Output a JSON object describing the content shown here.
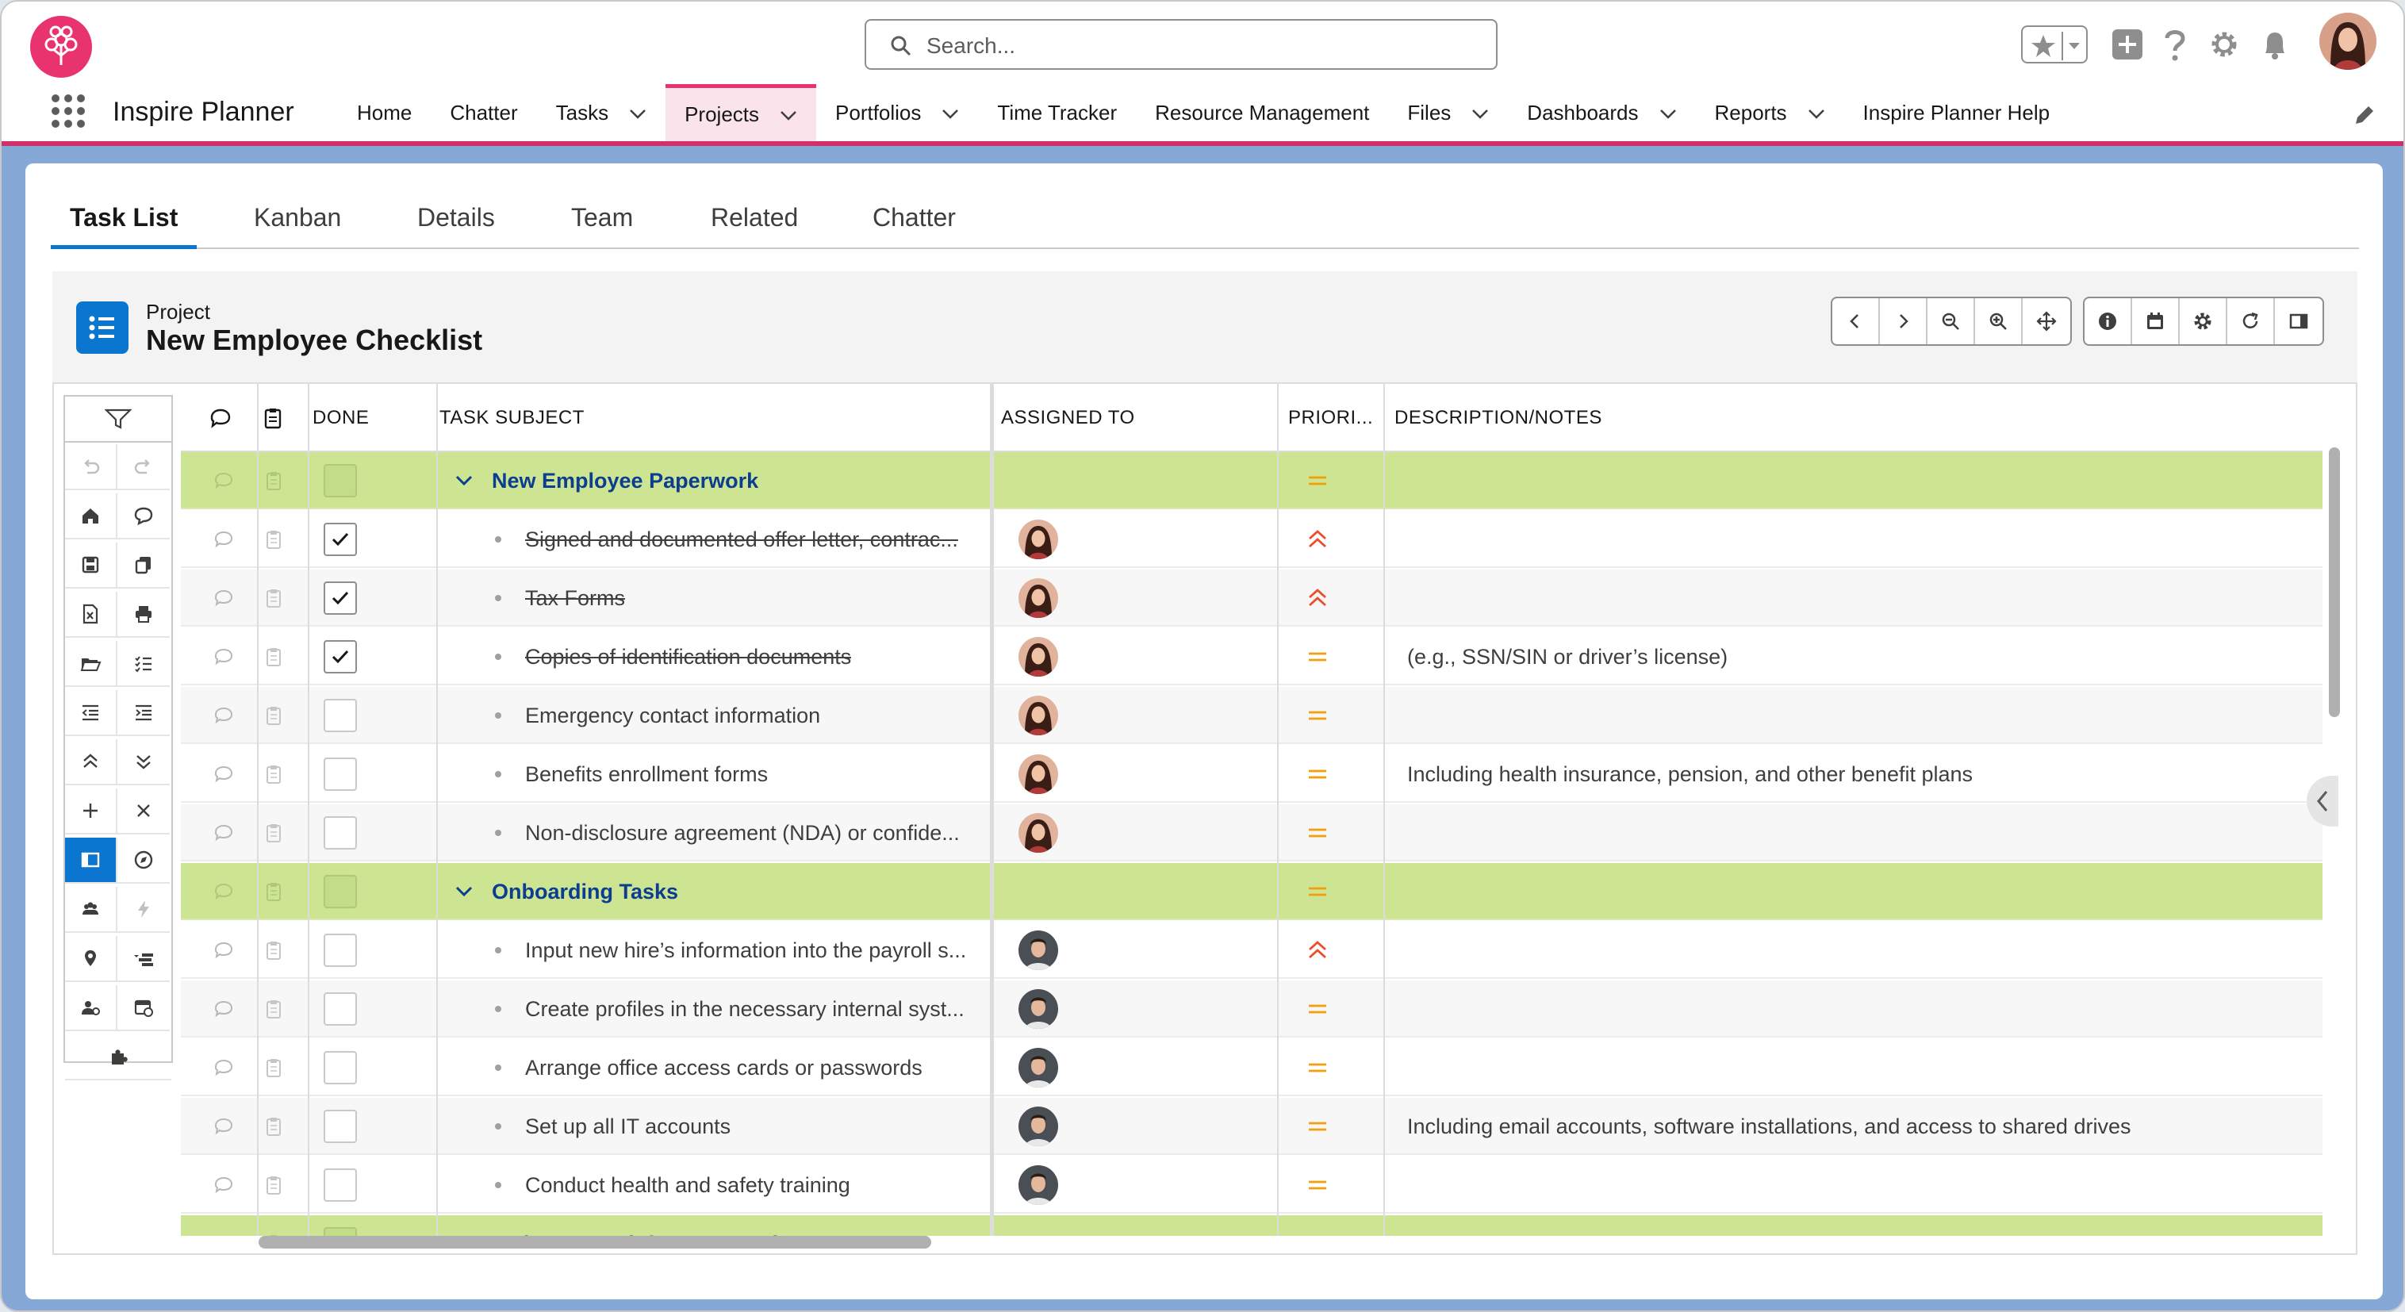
{
  "header": {
    "search_placeholder": "Search...",
    "app_name": "Inspire Planner",
    "icons": [
      "favorites-star-icon",
      "add-icon",
      "help-icon",
      "setup-gear-icon",
      "notifications-bell-icon",
      "user-avatar"
    ]
  },
  "nav": {
    "items": [
      {
        "label": "Home",
        "dropdown": false
      },
      {
        "label": "Chatter",
        "dropdown": false
      },
      {
        "label": "Tasks",
        "dropdown": true
      },
      {
        "label": "Projects",
        "dropdown": true,
        "active": true
      },
      {
        "label": "Portfolios",
        "dropdown": true
      },
      {
        "label": "Time Tracker",
        "dropdown": false
      },
      {
        "label": "Resource Management",
        "dropdown": false
      },
      {
        "label": "Files",
        "dropdown": true
      },
      {
        "label": "Dashboards",
        "dropdown": true
      },
      {
        "label": "Reports",
        "dropdown": true
      },
      {
        "label": "Inspire Planner Help",
        "dropdown": false
      }
    ]
  },
  "tabs": [
    "Task List",
    "Kanban",
    "Details",
    "Team",
    "Related",
    "Chatter"
  ],
  "active_tab": "Task List",
  "project": {
    "label": "Project",
    "title": "New Employee Checklist"
  },
  "columns": {
    "done": "DONE",
    "subject": "TASK SUBJECT",
    "assigned": "ASSIGNED TO",
    "priority": "PRIORI...",
    "description": "DESCRIPTION/NOTES"
  },
  "rows": [
    {
      "type": "group",
      "subject": "New Employee Paperwork",
      "priority": "normal",
      "description": ""
    },
    {
      "type": "task",
      "subject": "Signed and documented offer letter, contrac...",
      "done": true,
      "assignee": "woman",
      "priority": "high",
      "description": ""
    },
    {
      "type": "task",
      "subject": "Tax Forms",
      "done": true,
      "assignee": "woman",
      "priority": "high",
      "description": ""
    },
    {
      "type": "task",
      "subject": "Copies of identification documents",
      "done": true,
      "assignee": "woman",
      "priority": "normal",
      "description": "(e.g., SSN/SIN or driver’s license)"
    },
    {
      "type": "task",
      "subject": "Emergency contact information",
      "done": false,
      "assignee": "woman",
      "priority": "normal",
      "description": ""
    },
    {
      "type": "task",
      "subject": "Benefits enrollment forms",
      "done": false,
      "assignee": "woman",
      "priority": "normal",
      "description": "Including health insurance, pension, and other benefit plans"
    },
    {
      "type": "task",
      "subject": "Non-disclosure agreement (NDA) or confide...",
      "done": false,
      "assignee": "woman",
      "priority": "normal",
      "description": ""
    },
    {
      "type": "group",
      "subject": "Onboarding Tasks",
      "priority": "normal",
      "description": ""
    },
    {
      "type": "task",
      "subject": "Input new hire’s information into the payroll s...",
      "done": false,
      "assignee": "man",
      "priority": "high",
      "description": ""
    },
    {
      "type": "task",
      "subject": "Create profiles in the necessary internal syst...",
      "done": false,
      "assignee": "man",
      "priority": "normal",
      "description": ""
    },
    {
      "type": "task",
      "subject": "Arrange office access cards or passwords",
      "done": false,
      "assignee": "man",
      "priority": "normal",
      "description": ""
    },
    {
      "type": "task",
      "subject": "Set up all IT accounts",
      "done": false,
      "assignee": "man",
      "priority": "normal",
      "description": "Including email accounts, software installations, and access to shared drives"
    },
    {
      "type": "task",
      "subject": "Conduct health and safety training",
      "done": false,
      "assignee": "man",
      "priority": "normal",
      "description": ""
    },
    {
      "type": "group",
      "subject": "Welcome pack for new employee",
      "priority": "normal",
      "description": ""
    }
  ],
  "colors": {
    "brand": "#e8336e",
    "accent": "#0b76d0",
    "group_row": "#cde593",
    "priority_normal": "#f59e0b",
    "priority_high": "#ef4a2a"
  }
}
